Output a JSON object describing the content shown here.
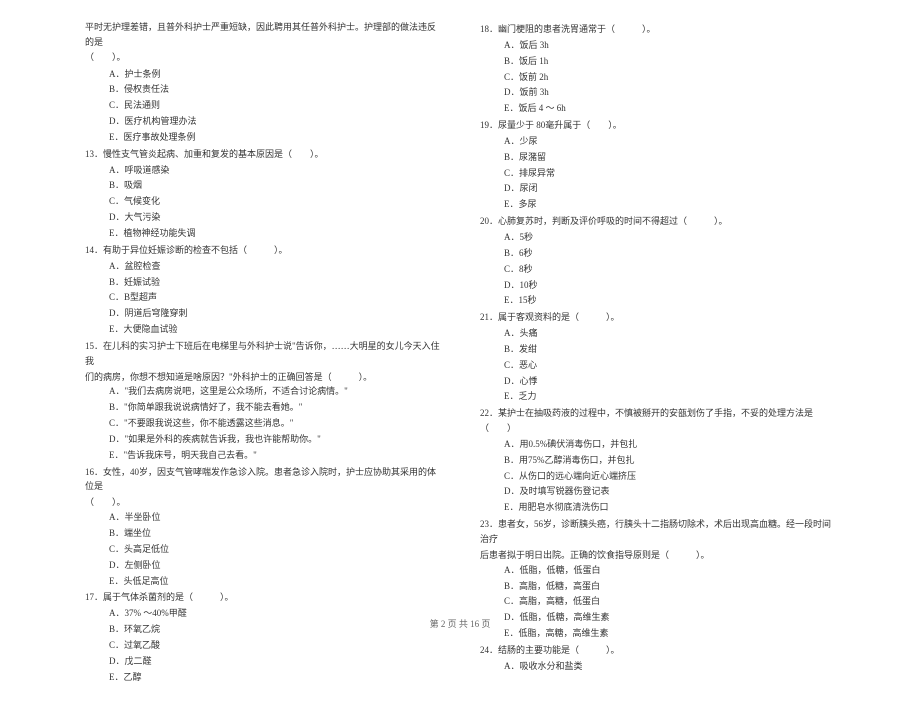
{
  "left": {
    "intro_line1": "平时无护理差错，且普外科护士严重短缺，因此聘用其任普外科护士。护理部的做法违反的是",
    "intro_line2": "（　　）。",
    "q12_opts": {
      "A": "护士条例",
      "B": "侵权责任法",
      "C": "民法通则",
      "D": "医疗机构管理办法",
      "E": "医疗事故处理条例"
    },
    "q13": "13．慢性支气管炎起病、加重和复发的基本原因是（　　）。",
    "q13_opts": {
      "A": "呼吸道感染",
      "B": "吸烟",
      "C": "气候变化",
      "D": "大气污染",
      "E": "植物神经功能失调"
    },
    "q14": "14．有助于异位妊娠诊断的检查不包括（　　　）。",
    "q14_opts": {
      "A": "盆腔检查",
      "B": "妊娠试验",
      "C": "B型超声",
      "D": "阴道后穹隆穿刺",
      "E": "大便隐血试验"
    },
    "q15_line1": "15．在儿科的实习护士下班后在电梯里与外科护士说\"告诉你，……大明星的女儿今天入住我",
    "q15_line2": "们的病房，你想不想知道是啥原因？\"外科护士的正确回答是（　　　）。",
    "q15_opts": {
      "A": "\"我们去病房说吧，这里是公众场所，不适合讨论病情。\"",
      "B": "\"你简单跟我说说病情好了，我不能去看她。\"",
      "C": "\"不要跟我说这些，你不能透露这些消息。\"",
      "D": "\"如果是外科的疾病就告诉我，我也许能帮助你。\"",
      "E": "\"告诉我床号，明天我自己去看。\""
    },
    "q16_line1": "16．女性，40岁，因支气管哮喘发作急诊入院。患者急诊入院时，护士应协助其采用的体位是",
    "q16_line2": "（　　）。",
    "q16_opts": {
      "A": "半坐卧位",
      "B": "端坐位",
      "C": "头高足低位",
      "D": "左侧卧位",
      "E": "头低足高位"
    },
    "q17": "17．属于气体杀菌剂的是（　　　）。",
    "q17_opts": {
      "A": "37% ～40%甲醛",
      "B": "环氧乙烷",
      "C": "过氧乙酸",
      "D": "戊二醛",
      "E": "乙醇"
    }
  },
  "right": {
    "q18": "18．幽门梗阻的患者洗胃通常于（　　　）。",
    "q18_opts": {
      "A": "饭后 3h",
      "B": "饭后 1h",
      "C": "饭前 2h",
      "D": "饭前 3h",
      "E": "饭后 4 ～ 6h"
    },
    "q19": "19．尿量少于  80毫升属于（　　）。",
    "q19_opts": {
      "A": "少尿",
      "B": "尿潴留",
      "C": "排尿异常",
      "D": "尿闭",
      "E": "多尿"
    },
    "q20": "20．心肺复苏时，判断及评价呼吸的时间不得超过（　　　）。",
    "q20_opts": {
      "A": "5秒",
      "B": "6秒",
      "C": "8秒",
      "D": "10秒",
      "E": "15秒"
    },
    "q21": "21．属于客观资料的是（　　　）。",
    "q21_opts": {
      "A": "头痛",
      "B": "发绀",
      "C": "恶心",
      "D": "心悸",
      "E": "乏力"
    },
    "q22": "22．某护士在抽吸药液的过程中，不慎被掰开的安瓿划伤了手指，不妥的处理方法是（　　）",
    "q22_opts": {
      "A": "用0.5%碘伏消毒伤口，并包扎",
      "B": "用75%乙醇消毒伤口，并包扎",
      "C": "从伤口的远心端向近心端挤压",
      "D": "及时填写锐器伤登记表",
      "E": "用肥皂水彻底清洗伤口"
    },
    "q23_line1": "23．患者女，56岁，诊断胰头癌，行胰头十二指肠切除术，术后出现高血糖。经一段时间治疗",
    "q23_line2": "后患者拟于明日出院。正确的饮食指导原则是（　　　）。",
    "q23_opts": {
      "A": "低脂，低糖，低蛋白",
      "B": "高脂，低糖，高蛋白",
      "C": "高脂，高糖，低蛋白",
      "D": "低脂，低糖，高维生素",
      "E": "低脂，高糖，高维生素"
    },
    "q24": "24．结肠的主要功能是（　　　）。",
    "q24_opts": {
      "A": "吸收水分和盐类"
    }
  },
  "footer": "第 2 页 共 16 页"
}
